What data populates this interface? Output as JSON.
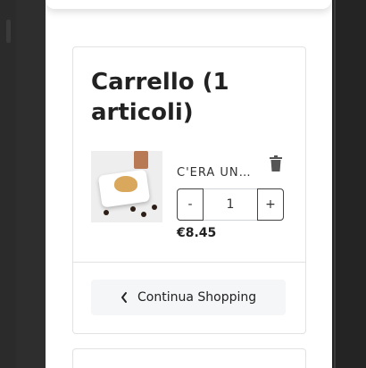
{
  "cart": {
    "title": "Carrello (1 articoli)",
    "item": {
      "name": "C'ERA UNA VOLTA",
      "quantity": "1",
      "minus_label": "-",
      "plus_label": "+",
      "price": "€8.45"
    },
    "continue_label": "Continua Shopping"
  },
  "icons": {
    "trash": "trash-icon",
    "chevron": "chevron-left-icon"
  }
}
